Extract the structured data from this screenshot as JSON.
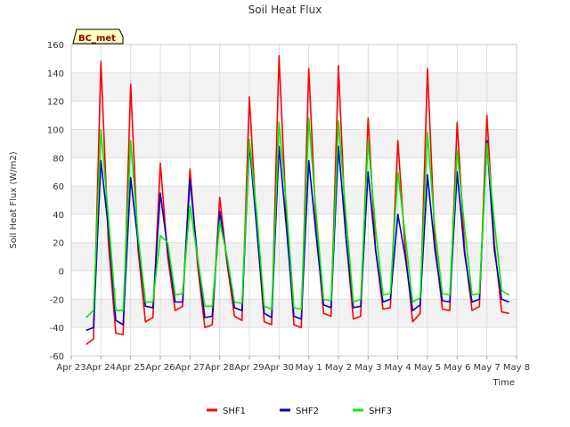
{
  "chart_data": {
    "type": "line",
    "title": "Soil Heat Flux",
    "xlabel": "Time",
    "ylabel": "Soil Heat Flux (W/m2)",
    "badge": "BC_met",
    "ylim": [
      -60,
      160
    ],
    "yticks": [
      -60,
      -40,
      -20,
      0,
      20,
      40,
      60,
      80,
      100,
      120,
      140,
      160
    ],
    "xlim": [
      "2023-04-23",
      "2023-05-08"
    ],
    "xticks": [
      {
        "date": "2023-04-23",
        "label": "Apr 23"
      },
      {
        "date": "2023-04-24",
        "label": "Apr 24"
      },
      {
        "date": "2023-04-25",
        "label": "Apr 25"
      },
      {
        "date": "2023-04-26",
        "label": "Apr 26"
      },
      {
        "date": "2023-04-27",
        "label": "Apr 27"
      },
      {
        "date": "2023-04-28",
        "label": "Apr 28"
      },
      {
        "date": "2023-04-29",
        "label": "Apr 29"
      },
      {
        "date": "2023-04-30",
        "label": "Apr 30"
      },
      {
        "date": "2023-05-01",
        "label": "May 1"
      },
      {
        "date": "2023-05-02",
        "label": "May 2"
      },
      {
        "date": "2023-05-03",
        "label": "May 3"
      },
      {
        "date": "2023-05-04",
        "label": "May 4"
      },
      {
        "date": "2023-05-05",
        "label": "May 5"
      },
      {
        "date": "2023-05-06",
        "label": "May 6"
      },
      {
        "date": "2023-05-07",
        "label": "May 7"
      },
      {
        "date": "2023-05-08",
        "label": "May 8"
      }
    ],
    "grid": true,
    "banded_background": true,
    "legend_position": "bottom-center",
    "series": [
      {
        "name": "SHF1",
        "color": "#ff0000",
        "points": [
          [
            "2023-04-23T12:00",
            -52
          ],
          [
            "2023-04-23T18:00",
            -48
          ],
          [
            "2023-04-24T00:00",
            148
          ],
          [
            "2023-04-24T06:00",
            20
          ],
          [
            "2023-04-24T12:00",
            -44
          ],
          [
            "2023-04-24T18:00",
            -45
          ],
          [
            "2023-04-25T00:00",
            132
          ],
          [
            "2023-04-25T06:00",
            15
          ],
          [
            "2023-04-25T12:00",
            -36
          ],
          [
            "2023-04-25T18:00",
            -33
          ],
          [
            "2023-04-26T00:00",
            76
          ],
          [
            "2023-04-26T06:00",
            10
          ],
          [
            "2023-04-26T12:00",
            -28
          ],
          [
            "2023-04-26T18:00",
            -25
          ],
          [
            "2023-04-27T00:00",
            72
          ],
          [
            "2023-04-27T06:00",
            5
          ],
          [
            "2023-04-27T12:00",
            -40
          ],
          [
            "2023-04-27T18:00",
            -38
          ],
          [
            "2023-04-28T00:00",
            52
          ],
          [
            "2023-04-28T06:00",
            5
          ],
          [
            "2023-04-28T12:00",
            -32
          ],
          [
            "2023-04-28T18:00",
            -35
          ],
          [
            "2023-04-29T00:00",
            123
          ],
          [
            "2023-04-29T06:00",
            30
          ],
          [
            "2023-04-29T12:00",
            -36
          ],
          [
            "2023-04-29T18:00",
            -38
          ],
          [
            "2023-04-30T00:00",
            152
          ],
          [
            "2023-04-30T06:00",
            35
          ],
          [
            "2023-04-30T12:00",
            -38
          ],
          [
            "2023-04-30T18:00",
            -40
          ],
          [
            "2023-05-01T00:00",
            143
          ],
          [
            "2023-05-01T06:00",
            30
          ],
          [
            "2023-05-01T12:00",
            -30
          ],
          [
            "2023-05-01T18:00",
            -32
          ],
          [
            "2023-05-02T00:00",
            145
          ],
          [
            "2023-05-02T06:00",
            25
          ],
          [
            "2023-05-02T12:00",
            -34
          ],
          [
            "2023-05-02T18:00",
            -32
          ],
          [
            "2023-05-03T00:00",
            108
          ],
          [
            "2023-05-03T06:00",
            15
          ],
          [
            "2023-05-03T12:00",
            -27
          ],
          [
            "2023-05-03T18:00",
            -26
          ],
          [
            "2023-05-04T00:00",
            92
          ],
          [
            "2023-05-04T06:00",
            15
          ],
          [
            "2023-05-04T12:00",
            -36
          ],
          [
            "2023-05-04T18:00",
            -30
          ],
          [
            "2023-05-05T00:00",
            143
          ],
          [
            "2023-05-05T06:00",
            20
          ],
          [
            "2023-05-05T12:00",
            -27
          ],
          [
            "2023-05-05T18:00",
            -28
          ],
          [
            "2023-05-06T00:00",
            105
          ],
          [
            "2023-05-06T06:00",
            15
          ],
          [
            "2023-05-06T12:00",
            -28
          ],
          [
            "2023-05-06T18:00",
            -25
          ],
          [
            "2023-05-07T00:00",
            110
          ],
          [
            "2023-05-07T06:00",
            20
          ],
          [
            "2023-05-07T12:00",
            -29
          ],
          [
            "2023-05-07T18:00",
            -30
          ]
        ]
      },
      {
        "name": "SHF2",
        "color": "#0000cc",
        "points": [
          [
            "2023-04-23T12:00",
            -42
          ],
          [
            "2023-04-23T18:00",
            -40
          ],
          [
            "2023-04-24T00:00",
            78
          ],
          [
            "2023-04-24T06:00",
            30
          ],
          [
            "2023-04-24T12:00",
            -35
          ],
          [
            "2023-04-24T18:00",
            -38
          ],
          [
            "2023-04-25T00:00",
            66
          ],
          [
            "2023-04-25T06:00",
            20
          ],
          [
            "2023-04-25T12:00",
            -25
          ],
          [
            "2023-04-25T18:00",
            -26
          ],
          [
            "2023-04-26T00:00",
            55
          ],
          [
            "2023-04-26T06:00",
            15
          ],
          [
            "2023-04-26T12:00",
            -22
          ],
          [
            "2023-04-26T18:00",
            -22
          ],
          [
            "2023-04-27T00:00",
            65
          ],
          [
            "2023-04-27T06:00",
            10
          ],
          [
            "2023-04-27T12:00",
            -33
          ],
          [
            "2023-04-27T18:00",
            -32
          ],
          [
            "2023-04-28T00:00",
            42
          ],
          [
            "2023-04-28T06:00",
            8
          ],
          [
            "2023-04-28T12:00",
            -26
          ],
          [
            "2023-04-28T18:00",
            -28
          ],
          [
            "2023-04-29T00:00",
            90
          ],
          [
            "2023-04-29T06:00",
            30
          ],
          [
            "2023-04-29T12:00",
            -30
          ],
          [
            "2023-04-29T18:00",
            -33
          ],
          [
            "2023-04-30T00:00",
            88
          ],
          [
            "2023-04-30T06:00",
            30
          ],
          [
            "2023-04-30T12:00",
            -32
          ],
          [
            "2023-04-30T18:00",
            -34
          ],
          [
            "2023-05-01T00:00",
            78
          ],
          [
            "2023-05-01T06:00",
            25
          ],
          [
            "2023-05-01T12:00",
            -24
          ],
          [
            "2023-05-01T18:00",
            -26
          ],
          [
            "2023-05-02T00:00",
            88
          ],
          [
            "2023-05-02T06:00",
            25
          ],
          [
            "2023-05-02T12:00",
            -26
          ],
          [
            "2023-05-02T18:00",
            -25
          ],
          [
            "2023-05-03T00:00",
            70
          ],
          [
            "2023-05-03T06:00",
            15
          ],
          [
            "2023-05-03T12:00",
            -22
          ],
          [
            "2023-05-03T18:00",
            -20
          ],
          [
            "2023-05-04T00:00",
            40
          ],
          [
            "2023-05-04T06:00",
            10
          ],
          [
            "2023-05-04T12:00",
            -28
          ],
          [
            "2023-05-04T18:00",
            -24
          ],
          [
            "2023-05-05T00:00",
            68
          ],
          [
            "2023-05-05T06:00",
            15
          ],
          [
            "2023-05-05T12:00",
            -21
          ],
          [
            "2023-05-05T18:00",
            -22
          ],
          [
            "2023-05-06T00:00",
            70
          ],
          [
            "2023-05-06T06:00",
            12
          ],
          [
            "2023-05-06T12:00",
            -22
          ],
          [
            "2023-05-06T18:00",
            -20
          ],
          [
            "2023-05-07T00:00",
            92
          ],
          [
            "2023-05-07T06:00",
            15
          ],
          [
            "2023-05-07T12:00",
            -20
          ],
          [
            "2023-05-07T18:00",
            -22
          ]
        ]
      },
      {
        "name": "SHF3",
        "color": "#00ee00",
        "points": [
          [
            "2023-04-23T12:00",
            -33
          ],
          [
            "2023-04-23T18:00",
            -28
          ],
          [
            "2023-04-24T00:00",
            100
          ],
          [
            "2023-04-24T06:00",
            38
          ],
          [
            "2023-04-24T12:00",
            -28
          ],
          [
            "2023-04-24T18:00",
            -28
          ],
          [
            "2023-04-25T00:00",
            92
          ],
          [
            "2023-04-25T06:00",
            25
          ],
          [
            "2023-04-25T12:00",
            -22
          ],
          [
            "2023-04-25T18:00",
            -22
          ],
          [
            "2023-04-26T00:00",
            25
          ],
          [
            "2023-04-26T06:00",
            20
          ],
          [
            "2023-04-26T12:00",
            -17
          ],
          [
            "2023-04-26T18:00",
            -16
          ],
          [
            "2023-04-27T00:00",
            46
          ],
          [
            "2023-04-27T06:00",
            10
          ],
          [
            "2023-04-27T12:00",
            -25
          ],
          [
            "2023-04-27T18:00",
            -25
          ],
          [
            "2023-04-28T00:00",
            35
          ],
          [
            "2023-04-28T06:00",
            10
          ],
          [
            "2023-04-28T12:00",
            -22
          ],
          [
            "2023-04-28T18:00",
            -23
          ],
          [
            "2023-04-29T00:00",
            93
          ],
          [
            "2023-04-29T06:00",
            40
          ],
          [
            "2023-04-29T12:00",
            -25
          ],
          [
            "2023-04-29T18:00",
            -27
          ],
          [
            "2023-04-30T00:00",
            105
          ],
          [
            "2023-04-30T06:00",
            45
          ],
          [
            "2023-04-30T12:00",
            -26
          ],
          [
            "2023-04-30T18:00",
            -27
          ],
          [
            "2023-05-01T00:00",
            108
          ],
          [
            "2023-05-01T06:00",
            40
          ],
          [
            "2023-05-01T12:00",
            -20
          ],
          [
            "2023-05-01T18:00",
            -21
          ],
          [
            "2023-05-02T00:00",
            106
          ],
          [
            "2023-05-02T06:00",
            40
          ],
          [
            "2023-05-02T12:00",
            -22
          ],
          [
            "2023-05-02T18:00",
            -20
          ],
          [
            "2023-05-03T00:00",
            92
          ],
          [
            "2023-05-03T06:00",
            30
          ],
          [
            "2023-05-03T12:00",
            -17
          ],
          [
            "2023-05-03T18:00",
            -16
          ],
          [
            "2023-05-04T00:00",
            70
          ],
          [
            "2023-05-04T06:00",
            25
          ],
          [
            "2023-05-04T12:00",
            -22
          ],
          [
            "2023-05-04T18:00",
            -19
          ],
          [
            "2023-05-05T00:00",
            98
          ],
          [
            "2023-05-05T06:00",
            30
          ],
          [
            "2023-05-05T12:00",
            -16
          ],
          [
            "2023-05-05T18:00",
            -17
          ],
          [
            "2023-05-06T00:00",
            85
          ],
          [
            "2023-05-06T06:00",
            30
          ],
          [
            "2023-05-06T12:00",
            -17
          ],
          [
            "2023-05-06T18:00",
            -16
          ],
          [
            "2023-05-07T00:00",
            90
          ],
          [
            "2023-05-07T06:00",
            35
          ],
          [
            "2023-05-07T12:00",
            -14
          ],
          [
            "2023-05-07T18:00",
            -17
          ]
        ]
      }
    ]
  }
}
